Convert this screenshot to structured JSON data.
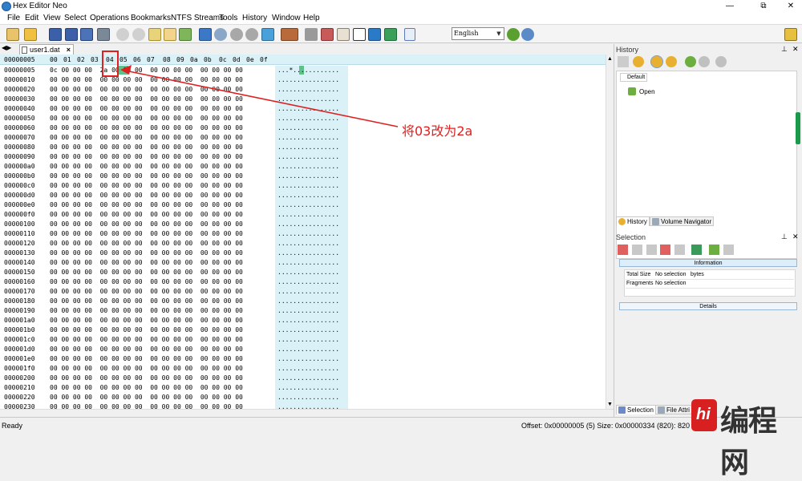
{
  "window": {
    "title": "Hex Editor Neo",
    "minimize": "—",
    "maximize": "⧉",
    "close": "✕"
  },
  "menu": [
    "File",
    "Edit",
    "View",
    "Select",
    "Operations",
    "Bookmarks",
    "NTFS Streams",
    "Tools",
    "History",
    "Window",
    "Help"
  ],
  "toolbar": {
    "language": "English"
  },
  "tab": {
    "filename": "user1.dat",
    "close": "×"
  },
  "editor": {
    "header_offset": "00000005",
    "columns": [
      "00",
      "01",
      "02",
      "03",
      "04",
      "05",
      "06",
      "07",
      "08",
      "09",
      "0a",
      "0b",
      "0c",
      "0d",
      "0e",
      "0f"
    ],
    "rows": [
      {
        "addr": "00000005",
        "hex": "0c 00 00 00  2a 00 00 00  00 00 00 00  00 00 00 00",
        "ascii": "...*............"
      },
      {
        "addr": "00000010",
        "hex": "00 00 00 00  00 00 00 00  00 00 00 00  00 00 00 00",
        "ascii": "................"
      },
      {
        "addr": "00000020",
        "hex": "00 00 00 00  00 00 00 00  00 00 00 00  00 00 00 00",
        "ascii": "................"
      },
      {
        "addr": "00000030",
        "hex": "00 00 00 00  00 00 00 00  00 00 00 00  00 00 00 00",
        "ascii": "................"
      },
      {
        "addr": "00000040",
        "hex": "00 00 00 00  00 00 00 00  00 00 00 00  00 00 00 00",
        "ascii": "................"
      },
      {
        "addr": "00000050",
        "hex": "00 00 00 00  00 00 00 00  00 00 00 00  00 00 00 00",
        "ascii": "................"
      },
      {
        "addr": "00000060",
        "hex": "00 00 00 00  00 00 00 00  00 00 00 00  00 00 00 00",
        "ascii": "................"
      },
      {
        "addr": "00000070",
        "hex": "00 00 00 00  00 00 00 00  00 00 00 00  00 00 00 00",
        "ascii": "................"
      },
      {
        "addr": "00000080",
        "hex": "00 00 00 00  00 00 00 00  00 00 00 00  00 00 00 00",
        "ascii": "................"
      },
      {
        "addr": "00000090",
        "hex": "00 00 00 00  00 00 00 00  00 00 00 00  00 00 00 00",
        "ascii": "................"
      },
      {
        "addr": "000000a0",
        "hex": "00 00 00 00  00 00 00 00  00 00 00 00  00 00 00 00",
        "ascii": "................"
      },
      {
        "addr": "000000b0",
        "hex": "00 00 00 00  00 00 00 00  00 00 00 00  00 00 00 00",
        "ascii": "................"
      },
      {
        "addr": "000000c0",
        "hex": "00 00 00 00  00 00 00 00  00 00 00 00  00 00 00 00",
        "ascii": "................"
      },
      {
        "addr": "000000d0",
        "hex": "00 00 00 00  00 00 00 00  00 00 00 00  00 00 00 00",
        "ascii": "................"
      },
      {
        "addr": "000000e0",
        "hex": "00 00 00 00  00 00 00 00  00 00 00 00  00 00 00 00",
        "ascii": "................"
      },
      {
        "addr": "000000f0",
        "hex": "00 00 00 00  00 00 00 00  00 00 00 00  00 00 00 00",
        "ascii": "................"
      },
      {
        "addr": "00000100",
        "hex": "00 00 00 00  00 00 00 00  00 00 00 00  00 00 00 00",
        "ascii": "................"
      },
      {
        "addr": "00000110",
        "hex": "00 00 00 00  00 00 00 00  00 00 00 00  00 00 00 00",
        "ascii": "................"
      },
      {
        "addr": "00000120",
        "hex": "00 00 00 00  00 00 00 00  00 00 00 00  00 00 00 00",
        "ascii": "................"
      },
      {
        "addr": "00000130",
        "hex": "00 00 00 00  00 00 00 00  00 00 00 00  00 00 00 00",
        "ascii": "................"
      },
      {
        "addr": "00000140",
        "hex": "00 00 00 00  00 00 00 00  00 00 00 00  00 00 00 00",
        "ascii": "................"
      },
      {
        "addr": "00000150",
        "hex": "00 00 00 00  00 00 00 00  00 00 00 00  00 00 00 00",
        "ascii": "................"
      },
      {
        "addr": "00000160",
        "hex": "00 00 00 00  00 00 00 00  00 00 00 00  00 00 00 00",
        "ascii": "................"
      },
      {
        "addr": "00000170",
        "hex": "00 00 00 00  00 00 00 00  00 00 00 00  00 00 00 00",
        "ascii": "................"
      },
      {
        "addr": "00000180",
        "hex": "00 00 00 00  00 00 00 00  00 00 00 00  00 00 00 00",
        "ascii": "................"
      },
      {
        "addr": "00000190",
        "hex": "00 00 00 00  00 00 00 00  00 00 00 00  00 00 00 00",
        "ascii": "................"
      },
      {
        "addr": "000001a0",
        "hex": "00 00 00 00  00 00 00 00  00 00 00 00  00 00 00 00",
        "ascii": "................"
      },
      {
        "addr": "000001b0",
        "hex": "00 00 00 00  00 00 00 00  00 00 00 00  00 00 00 00",
        "ascii": "................"
      },
      {
        "addr": "000001c0",
        "hex": "00 00 00 00  00 00 00 00  00 00 00 00  00 00 00 00",
        "ascii": "................"
      },
      {
        "addr": "000001d0",
        "hex": "00 00 00 00  00 00 00 00  00 00 00 00  00 00 00 00",
        "ascii": "................"
      },
      {
        "addr": "000001e0",
        "hex": "00 00 00 00  00 00 00 00  00 00 00 00  00 00 00 00",
        "ascii": "................"
      },
      {
        "addr": "000001f0",
        "hex": "00 00 00 00  00 00 00 00  00 00 00 00  00 00 00 00",
        "ascii": "................"
      },
      {
        "addr": "00000200",
        "hex": "00 00 00 00  00 00 00 00  00 00 00 00  00 00 00 00",
        "ascii": "................"
      },
      {
        "addr": "00000210",
        "hex": "00 00 00 00  00 00 00 00  00 00 00 00  00 00 00 00",
        "ascii": "................"
      },
      {
        "addr": "00000220",
        "hex": "00 00 00 00  00 00 00 00  00 00 00 00  00 00 00 00",
        "ascii": "................"
      },
      {
        "addr": "00000230",
        "hex": "00 00 00 00  00 00 00 00  00 00 00 00  00 00 00 00",
        "ascii": "................"
      }
    ]
  },
  "annotation": {
    "text": "将03改为2a",
    "color": "#e02020"
  },
  "history_panel": {
    "title": "History",
    "tab": "Default",
    "entry": "Open",
    "bottom_tabs": [
      "History",
      "Volume Navigator"
    ]
  },
  "selection_panel": {
    "title": "Selection",
    "information": "Information",
    "rows": [
      {
        "key": "Total Size",
        "value": "No selection",
        "unit": "bytes"
      },
      {
        "key": "Fragments",
        "value": "No selection",
        "unit": ""
      }
    ],
    "details": "Details",
    "bottom_tabs": [
      "Selection",
      "File Attri"
    ]
  },
  "status": {
    "ready": "Ready",
    "info": "Offset: 0x00000005 (5)  Size: 0x00000334 (820): 820  Hex"
  },
  "watermark": {
    "glyph": "hi",
    "text": "编程网"
  }
}
